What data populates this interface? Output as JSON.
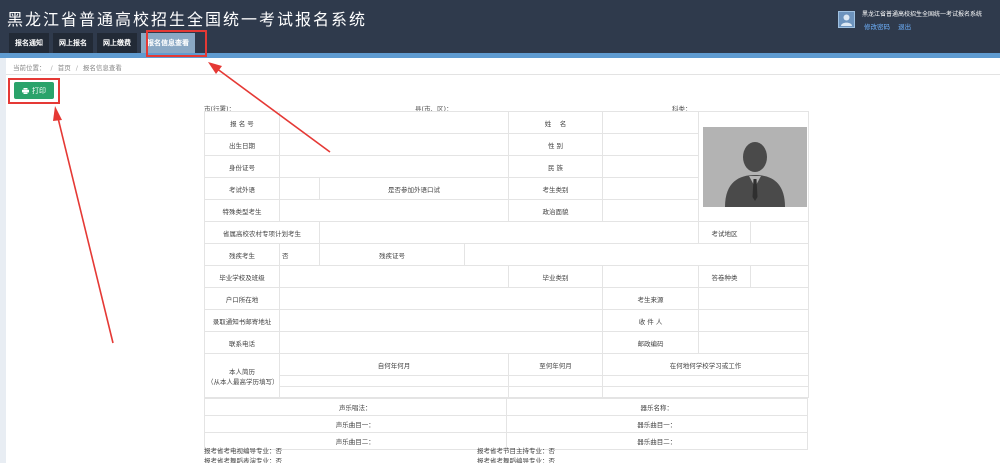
{
  "header": {
    "app_title": "黑龙江省普通高校招生全国统一考试报名系统",
    "user_name": "黑龙江省普通高校招生全国统一考试报名系统",
    "change_password": "修改密码",
    "logout": "退出"
  },
  "nav": {
    "tabs": [
      {
        "label": "报名通知"
      },
      {
        "label": "网上报名"
      },
      {
        "label": "网上缴费"
      },
      {
        "label": "报名信息查看",
        "active": true
      }
    ]
  },
  "breadcrumb": {
    "prefix": "当前位置：",
    "home": "首页",
    "current": "报名信息查看"
  },
  "toolbar": {
    "print_label": "打印"
  },
  "meta": {
    "city": "市(行署)：",
    "county": "县(市、区)：",
    "subject": "科类："
  },
  "form": {
    "reg_no": "报 名 号",
    "name": "姓　 名",
    "birth": "出生日期",
    "gender": "性 别",
    "id_no": "身份证号",
    "ethnic": "民 族",
    "foreign_lang": "考试外语",
    "oral_test": "是否参加外语口试",
    "exam_category": "考生类别",
    "special_type": "特殊类型考生",
    "political": "政治面貌",
    "rural_plan": "省属高校农村专项计划考生",
    "exam_area": "考试地区",
    "disabled": "残疾考生",
    "disabled_value": "否",
    "disabled_cert": "残疾证号",
    "grad_school": "毕业学校及班级",
    "grad_category": "毕业类别",
    "exam_language": "答卷种类",
    "hukou": "户口所在地",
    "origin": "考生来源",
    "mail_address": "录取通知书邮寄地址",
    "recipient": "收 件 人",
    "phone": "联系电话",
    "zip": "邮政编码",
    "resume": "本人简历",
    "resume_note": "（从本人最高学历填写）",
    "from_date": "自何年何月",
    "to_date": "至何年何月",
    "where": "在何地何学校学习或工作"
  },
  "music": {
    "vocal_style": "声乐唱法：",
    "instrument": "器乐名称：",
    "vocal_song1": "声乐曲目一：",
    "inst_song1": "器乐曲目一：",
    "vocal_song2": "声乐曲目二：",
    "inst_song2": "器乐曲目二："
  },
  "extra": {
    "line1_left": "报考省考电视编导专业：否",
    "line1_right": "报考省考节目主持专业：否",
    "line2_left": "报考省考舞蹈表演专业：否",
    "line2_right": "报考省考舞蹈编导专业：否"
  },
  "colors": {
    "header_bg": "#2f3a4c",
    "active_tab": "#8aa8c4",
    "print_btn": "#2aa36a",
    "annotation": "#e53935"
  }
}
